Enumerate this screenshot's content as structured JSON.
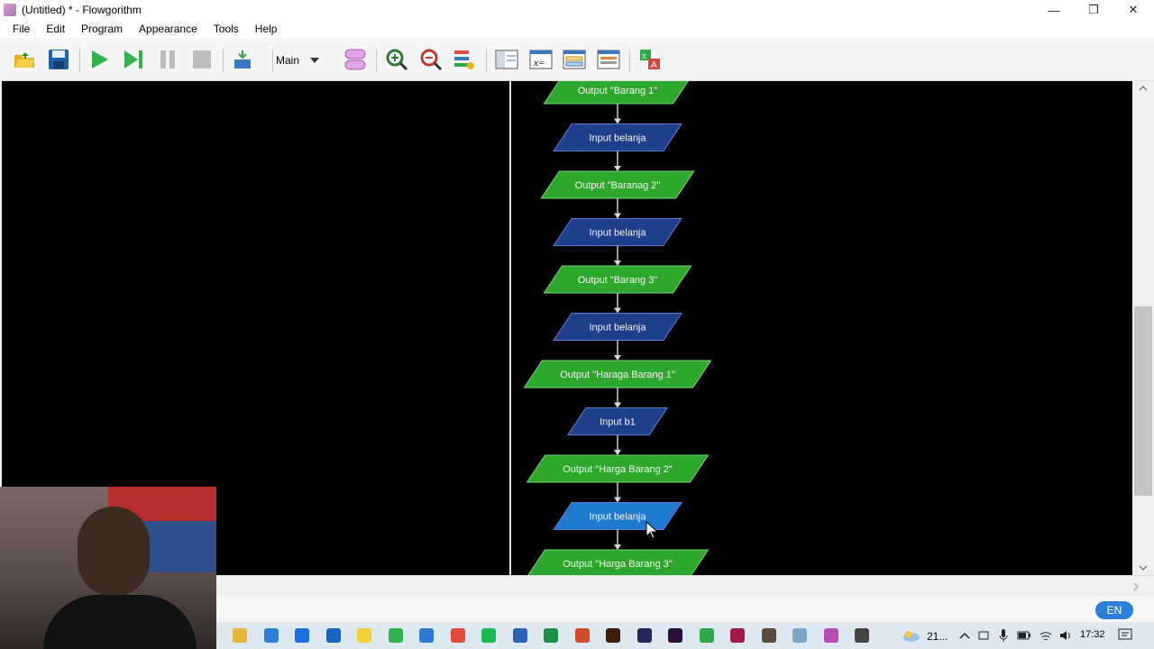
{
  "window": {
    "title": "(Untitled) * - Flowgorithm",
    "controls": {
      "minimize": "—",
      "restore": "❐",
      "close": "✕"
    }
  },
  "menu": [
    "File",
    "Edit",
    "Program",
    "Appearance",
    "Tools",
    "Help"
  ],
  "toolbar": {
    "function_select": "Main",
    "icons": [
      "open-icon",
      "save-icon",
      "run-icon",
      "step-icon",
      "pause-icon",
      "stop-icon",
      "layout-icon",
      "shape-icon",
      "zoom-in-icon",
      "zoom-out-icon",
      "style-icon",
      "panel-icon",
      "variables-icon",
      "console-icon",
      "translate-icon",
      "language-icon"
    ]
  },
  "flowchart": {
    "colors": {
      "output": "#2da82d",
      "input": "#1f3f8a",
      "input_selected": "#1f7bd0",
      "arrow": "#d8d8d8"
    },
    "nodes": [
      {
        "kind": "output",
        "label": "Output \"Barang 1\""
      },
      {
        "kind": "input",
        "label": "Input belanja"
      },
      {
        "kind": "output",
        "label": "Output \"Baranag 2\""
      },
      {
        "kind": "input",
        "label": "Input belanja"
      },
      {
        "kind": "output",
        "label": "Output \"Barang 3\""
      },
      {
        "kind": "input",
        "label": "Input belanja"
      },
      {
        "kind": "output",
        "label": "Output \"Haraga Barang 1\""
      },
      {
        "kind": "input",
        "label": "Input b1"
      },
      {
        "kind": "output",
        "label": "Output \"Harga Barang 2\""
      },
      {
        "kind": "input_selected",
        "label": "Input belanja"
      },
      {
        "kind": "output",
        "label": "Output \"Harga Barang 3\""
      }
    ]
  },
  "status": {
    "language": "EN"
  },
  "taskbar": {
    "weather": "21...",
    "clock": "17:32",
    "apps": [
      "file-explorer-icon",
      "mail-icon",
      "dropbox-icon",
      "outlook-icon",
      "notes-icon",
      "whatsapp-icon",
      "vscode-icon",
      "chrome-icon",
      "spotify-icon",
      "word-icon",
      "excel-icon",
      "powerpoint-icon",
      "illustrator-icon",
      "photoshop-icon",
      "premiere-icon",
      "maps-icon",
      "viva-icon",
      "character-icon",
      "notepad-icon",
      "flowgorithm-icon",
      "obs-icon"
    ]
  }
}
